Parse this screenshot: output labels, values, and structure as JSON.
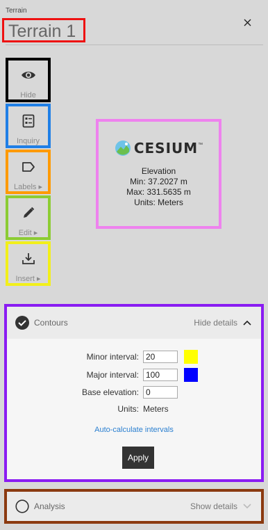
{
  "header": {
    "breadcrumb": "Terrain",
    "title": "Terrain 1",
    "close_glyph": "×"
  },
  "toolbar": {
    "hide": {
      "label": "Hide",
      "icon": "eye-icon"
    },
    "inquiry": {
      "label": "Inquiry",
      "icon": "inquiry-icon"
    },
    "labels": {
      "label": "Labels ▸",
      "icon": "tag-icon"
    },
    "edit": {
      "label": "Edit ▸",
      "icon": "pencil-icon"
    },
    "insert": {
      "label": "Insert ▸",
      "icon": "download-icon"
    }
  },
  "preview": {
    "logo_text": "CESIUM",
    "logo_mark": "™",
    "lines": [
      "Elevation",
      "Min: 37.2027 m",
      "Max: 331.5635 m",
      "Units: Meters"
    ]
  },
  "contours": {
    "title": "Contours",
    "toggle_label": "Hide details",
    "minor_label": "Minor interval:",
    "minor_value": "20",
    "minor_color": "#ffff00",
    "major_label": "Major interval:",
    "major_value": "100",
    "major_color": "#0000ff",
    "base_label": "Base elevation:",
    "base_value": "0",
    "units_label": "Units:",
    "units_value": "Meters",
    "auto_link": "Auto-calculate intervals",
    "apply_label": "Apply"
  },
  "analysis": {
    "title": "Analysis",
    "toggle_label": "Show details"
  },
  "colors": {
    "title_box": "#ee1111",
    "hide_box": "#000000",
    "inquiry_box": "#1f7fe6",
    "labels_box": "#ff9a00",
    "edit_box": "#8ccc33",
    "insert_box": "#f2ef1a",
    "preview_box": "#ee82ee",
    "contours_box": "#8a1cf2",
    "analysis_box": "#8b3a10"
  }
}
